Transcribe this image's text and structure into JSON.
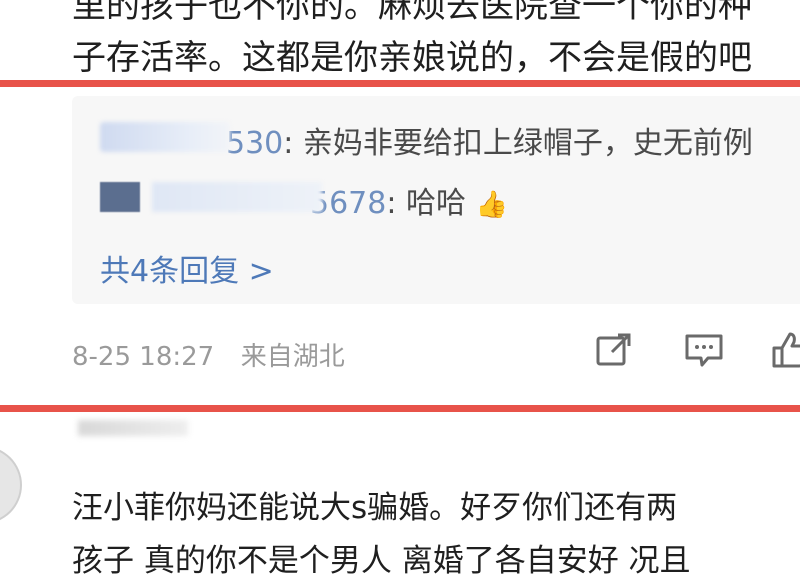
{
  "comment_top": {
    "line1_partial": "里的孩子也不你的。麻烦去医院查一个你的种",
    "line2": "子存活率。这都是你亲娘说的，不会是假的吧"
  },
  "replies": [
    {
      "name_tail": "530",
      "text": ": 亲妈非要给扣上绿帽子，史无前例"
    },
    {
      "name_tail": "5678",
      "text": ": 哈哈"
    }
  ],
  "more_replies": "共4条回复 >",
  "meta": {
    "date": "8-25 18:27",
    "location": "来自湖北"
  },
  "next_comment": {
    "line1": "汪小菲你妈还能说大s骗婚。好歹你们还有两",
    "line2": "孩子 真的你不是个男人 离婚了各自安好 况且"
  },
  "colors": {
    "highlight": "#e8534a",
    "link": "#4e79b8",
    "reply_bg": "#f7f7f7"
  },
  "icons": [
    "share-icon",
    "comment-icon",
    "like-icon",
    "thumbs-up-emoji"
  ]
}
